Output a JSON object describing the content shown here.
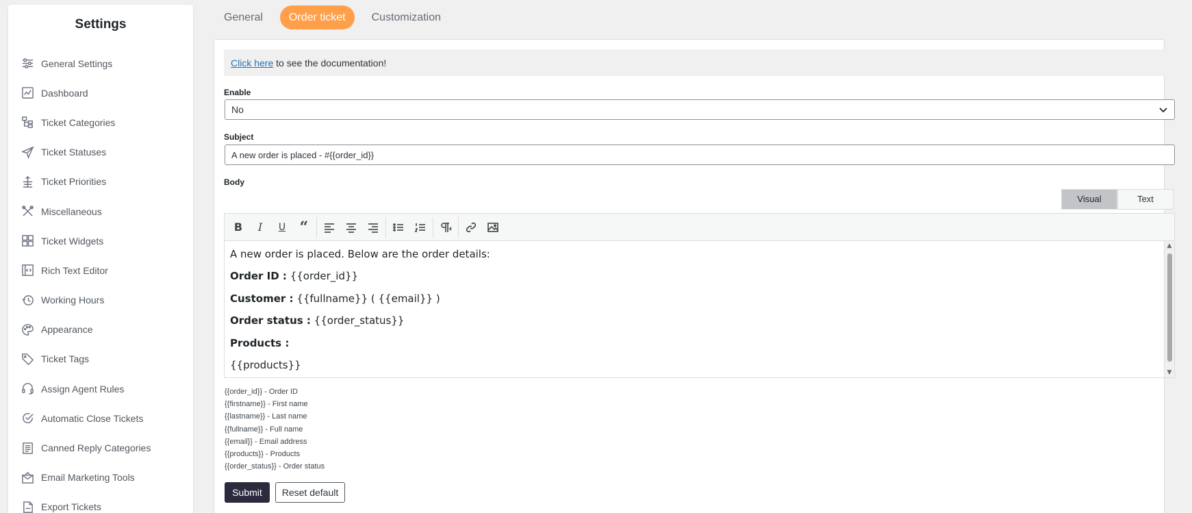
{
  "sidebar": {
    "title": "Settings",
    "items": [
      {
        "label": "General Settings",
        "icon": "sliders-icon"
      },
      {
        "label": "Dashboard",
        "icon": "chart-icon"
      },
      {
        "label": "Ticket Categories",
        "icon": "hierarchy-icon"
      },
      {
        "label": "Ticket Statuses",
        "icon": "send-icon"
      },
      {
        "label": "Ticket Priorities",
        "icon": "priority-icon"
      },
      {
        "label": "Miscellaneous",
        "icon": "tools-icon"
      },
      {
        "label": "Ticket Widgets",
        "icon": "widgets-icon"
      },
      {
        "label": "Rich Text Editor",
        "icon": "code-window-icon"
      },
      {
        "label": "Working Hours",
        "icon": "clock-history-icon"
      },
      {
        "label": "Appearance",
        "icon": "palette-icon"
      },
      {
        "label": "Ticket Tags",
        "icon": "tag-icon"
      },
      {
        "label": "Assign Agent Rules",
        "icon": "headset-icon"
      },
      {
        "label": "Automatic Close Tickets",
        "icon": "check-circle-icon"
      },
      {
        "label": "Canned Reply Categories",
        "icon": "document-list-icon"
      },
      {
        "label": "Email Marketing Tools",
        "icon": "envelope-icon"
      },
      {
        "label": "Export Tickets",
        "icon": "csv-icon"
      }
    ]
  },
  "tabs": [
    {
      "label": "General",
      "active": false
    },
    {
      "label": "Order ticket",
      "active": true
    },
    {
      "label": "Customization",
      "active": false
    }
  ],
  "doc_banner": {
    "link_text": "Click here",
    "rest": " to see the documentation!"
  },
  "enable": {
    "label": "Enable",
    "value": "No"
  },
  "subject": {
    "label": "Subject",
    "value": "A new order is placed - #{{order_id}}"
  },
  "body": {
    "label": "Body",
    "mode_visual": "Visual",
    "mode_text": "Text",
    "content": [
      {
        "bold": "",
        "text": "A new order is placed. Below are the order details:"
      },
      {
        "bold": "Order ID :",
        "text": " {{order_id}}"
      },
      {
        "bold": "Customer :",
        "text": " {{fullname}} ( {{email}} )"
      },
      {
        "bold": "Order status :",
        "text": " {{order_status}}"
      },
      {
        "bold": "Products :",
        "text": ""
      },
      {
        "bold": "",
        "text": "{{products}}"
      }
    ]
  },
  "legend": [
    "{{order_id}} - Order ID",
    "{{firstname}} - First name",
    "{{lastname}} - Last name",
    "{{fullname}} - Full name",
    "{{email}} - Email address",
    "{{products}} - Products",
    "{{order_status}} - Order status"
  ],
  "buttons": {
    "submit": "Submit",
    "reset": "Reset default"
  },
  "colors": {
    "accent": "#ff9f4a",
    "submit_bg": "#2c2a3e"
  }
}
